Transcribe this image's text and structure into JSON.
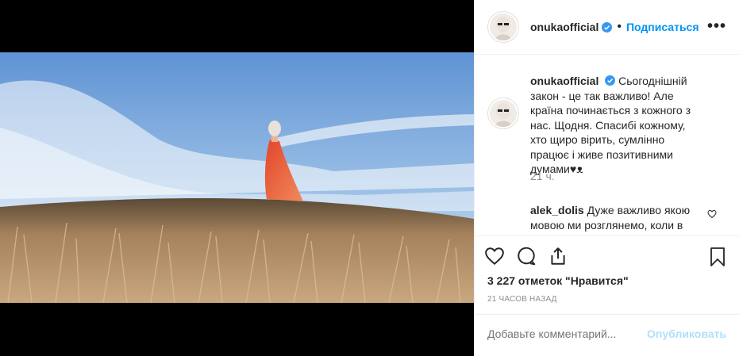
{
  "header": {
    "username": "onukaofficial",
    "follow_label": "Подписаться",
    "separator": "•",
    "more_glyph": "•••"
  },
  "caption": {
    "username": "onukaofficial",
    "text": "Сьогоднішній закон - це так важливо! Але країна починається з кожного з нас. Щодня. Спасибі кожному, хто щиро вірить, сумлінно працює і живе позитивними думами♥ᴥ",
    "time": "21 ч."
  },
  "comments": [
    {
      "username": "alek_dolis",
      "text": "Дуже важливо якою мовою ми розглянемо, коли в"
    }
  ],
  "stats": {
    "likes": "3 227 отметок \"Нравится\"",
    "posted": "21 часов назад"
  },
  "add_comment": {
    "placeholder": "Добавьте комментарий...",
    "publish_label": "Опубликовать"
  },
  "icons": [
    "verified-badge-icon",
    "more-options-icon",
    "like-heart-icon",
    "comment-icon",
    "share-icon",
    "bookmark-icon"
  ],
  "colors": {
    "link_blue": "#0095f6",
    "publish_disabled": "#b2dffc",
    "muted": "#8e8e8e",
    "verified": "#3897f0"
  }
}
